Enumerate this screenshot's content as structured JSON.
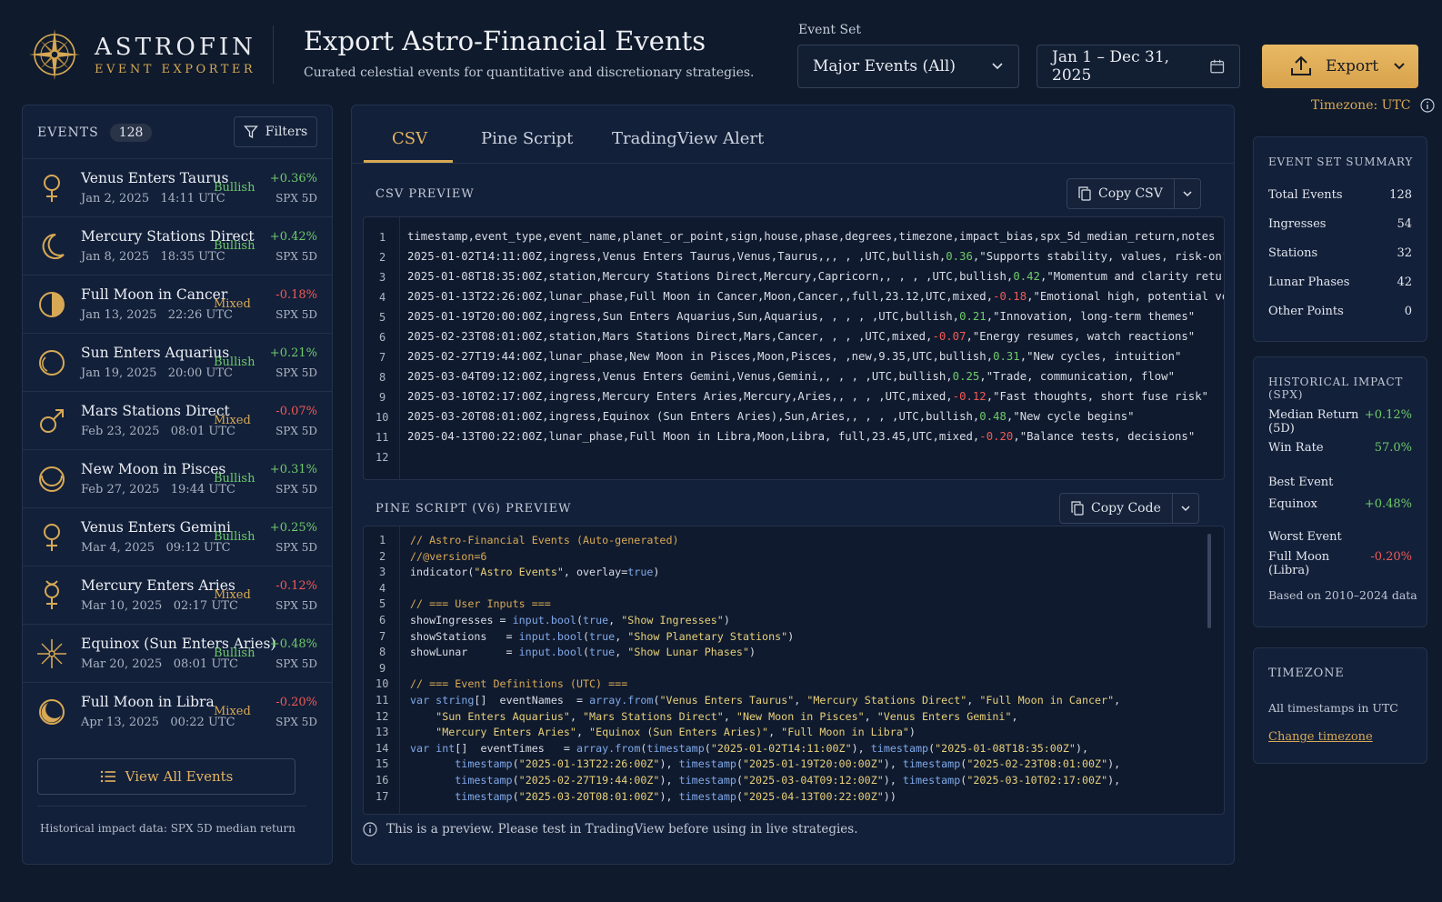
{
  "brand": {
    "title": "ASTROFIN",
    "subtitle": "EVENT EXPORTER"
  },
  "header": {
    "title": "Export Astro-Financial Events",
    "subtitle": "Curated celestial events for quantitative and discretionary strategies.",
    "event_set_label": "Event Set",
    "event_set_value": "Major Events (All)",
    "date_range": "Jan 1 – Dec 31, 2025",
    "export_label": "Export",
    "timezone_note": "Timezone: UTC"
  },
  "events_panel": {
    "title": "EVENTS",
    "count": "128",
    "filters_label": "Filters",
    "items": [
      {
        "glyph": "venus",
        "name": "Venus Enters Taurus",
        "date": "Jan 2, 2025",
        "time": "14:11 UTC",
        "bias": "Bullish",
        "bias_color": "#6ecb6a",
        "return": "+0.36%",
        "return_color": "#6ecb6a",
        "return_label": "SPX 5D"
      },
      {
        "glyph": "crescent",
        "name": "Mercury Stations Direct",
        "date": "Jan 8, 2025",
        "time": "18:35 UTC",
        "bias": "Bullish",
        "bias_color": "#6ecb6a",
        "return": "+0.42%",
        "return_color": "#6ecb6a",
        "return_label": "SPX 5D"
      },
      {
        "glyph": "fullmoon",
        "name": "Full Moon in Cancer",
        "date": "Jan 13, 2025",
        "time": "22:26 UTC",
        "bias": "Mixed",
        "bias_color": "#d7a955",
        "return": "-0.18%",
        "return_color": "#f05a55",
        "return_label": "SPX 5D"
      },
      {
        "glyph": "sun",
        "name": "Sun Enters Aquarius",
        "date": "Jan 19, 2025",
        "time": "20:00 UTC",
        "bias": "Bullish",
        "bias_color": "#6ecb6a",
        "return": "+0.21%",
        "return_color": "#6ecb6a",
        "return_label": "SPX 5D"
      },
      {
        "glyph": "mars",
        "name": "Mars Stations Direct",
        "date": "Feb 23, 2025",
        "time": "08:01 UTC",
        "bias": "Mixed",
        "bias_color": "#d7a955",
        "return": "-0.07%",
        "return_color": "#f05a55",
        "return_label": "SPX 5D"
      },
      {
        "glyph": "newmoon",
        "name": "New Moon in Pisces",
        "date": "Feb 27, 2025",
        "time": "19:44 UTC",
        "bias": "Bullish",
        "bias_color": "#6ecb6a",
        "return": "+0.31%",
        "return_color": "#6ecb6a",
        "return_label": "SPX 5D"
      },
      {
        "glyph": "venus",
        "name": "Venus Enters Gemini",
        "date": "Mar 4, 2025",
        "time": "09:12 UTC",
        "bias": "Bullish",
        "bias_color": "#6ecb6a",
        "return": "+0.25%",
        "return_color": "#6ecb6a",
        "return_label": "SPX 5D"
      },
      {
        "glyph": "mercury",
        "name": "Mercury Enters Aries",
        "date": "Mar 10, 2025",
        "time": "02:17 UTC",
        "bias": "Mixed",
        "bias_color": "#d7a955",
        "return": "-0.12%",
        "return_color": "#f05a55",
        "return_label": "SPX 5D"
      },
      {
        "glyph": "star",
        "name": "Equinox (Sun Enters Aries)",
        "date": "Mar 20, 2025",
        "time": "08:01 UTC",
        "bias": "Bullish",
        "bias_color": "#6ecb6a",
        "return": "+0.48%",
        "return_color": "#6ecb6a",
        "return_label": "SPX 5D"
      },
      {
        "glyph": "fullmoon2",
        "name": "Full Moon in Libra",
        "date": "Apr 13, 2025",
        "time": "00:22 UTC",
        "bias": "Mixed",
        "bias_color": "#d7a955",
        "return": "-0.20%",
        "return_color": "#f05a55",
        "return_label": "SPX 5D"
      }
    ],
    "view_all_label": "View All Events",
    "footnote": "Historical impact data: SPX 5D median return"
  },
  "tabs": [
    "CSV",
    "Pine Script",
    "TradingView Alert"
  ],
  "csv_preview": {
    "title": "CSV PREVIEW",
    "copy_label": "Copy CSV",
    "lines": [
      "timestamp,event_type,event_name,planet_or_point,sign,house,phase,degrees,timezone,impact_bias,spx_5d_median_return,notes",
      "2025-01-02T14:11:00Z,ingress,Venus Enters Taurus,Venus,Taurus,,, , ,UTC,bullish,0.36,\"Supports stability, values, risk-on\"",
      "2025-01-08T18:35:00Z,station,Mercury Stations Direct,Mercury,Capricorn,, , , ,UTC,bullish,0.42,\"Momentum and clarity return\"",
      "2025-01-13T22:26:00Z,lunar_phase,Full Moon in Cancer,Moon,Cancer,,full,23.12,UTC,mixed,-0.18,\"Emotional high, potential volatil",
      "2025-01-19T20:00:00Z,ingress,Sun Enters Aquarius,Sun,Aquarius, , , , ,UTC,bullish,0.21,\"Innovation, long-term themes\"",
      "2025-02-23T08:01:00Z,station,Mars Stations Direct,Mars,Cancer, , , ,UTC,mixed,-0.07,\"Energy resumes, watch reactions\"",
      "2025-02-27T19:44:00Z,lunar_phase,New Moon in Pisces,Moon,Pisces, ,new,9.35,UTC,bullish,0.31,\"New cycles, intuition\"",
      "2025-03-04T09:12:00Z,ingress,Venus Enters Gemini,Venus,Gemini,, , , ,UTC,bullish,0.25,\"Trade, communication, flow\"",
      "2025-03-10T02:17:00Z,ingress,Mercury Enters Aries,Mercury,Aries,, , , ,UTC,mixed,-0.12,\"Fast thoughts, short fuse risk\"",
      "2025-03-20T08:01:00Z,ingress,Equinox (Sun Enters Aries),Sun,Aries,, , , ,UTC,bullish,0.48,\"New cycle begins\"",
      "2025-04-13T00:22:00Z,lunar_phase,Full Moon in Libra,Moon,Libra, full,23.45,UTC,mixed,-0.20,\"Balance tests, decisions\"",
      ""
    ]
  },
  "pine_preview": {
    "title": "PINE SCRIPT (V6) PREVIEW",
    "copy_label": "Copy Code",
    "lines": [
      "// Astro-Financial Events (Auto-generated)",
      "//@version=6",
      "indicator(\"Astro Events\", overlay=true)",
      "",
      "// === User Inputs ===",
      "showIngresses = input.bool(true, \"Show Ingresses\")",
      "showStations   = input.bool(true, \"Show Planetary Stations\")",
      "showLunar      = input.bool(true, \"Show Lunar Phases\")",
      "",
      "// === Event Definitions (UTC) ===",
      "var string[]  eventNames  = array.from(\"Venus Enters Taurus\", \"Mercury Stations Direct\", \"Full Moon in Cancer\",",
      "    \"Sun Enters Aquarius\", \"Mars Stations Direct\", \"New Moon in Pisces\", \"Venus Enters Gemini\",",
      "    \"Mercury Enters Aries\", \"Equinox (Sun Enters Aries)\", \"Full Moon in Libra\")",
      "var int[]  eventTimes   = array.from(timestamp(\"2025-01-02T14:11:00Z\"), timestamp(\"2025-01-08T18:35:00Z\"),",
      "       timestamp(\"2025-01-13T22:26:00Z\"), timestamp(\"2025-01-19T20:00:00Z\"), timestamp(\"2025-02-23T08:01:00Z\"),",
      "       timestamp(\"2025-02-27T19:44:00Z\"), timestamp(\"2025-03-04T09:12:00Z\"), timestamp(\"2025-03-10T02:17:00Z\"),",
      "       timestamp(\"2025-03-20T08:01:00Z\"), timestamp(\"2025-04-13T00:22:00Z\"))"
    ],
    "note": "This is a preview. Please test in TradingView before using in live strategies."
  },
  "summary": {
    "title": "EVENT SET SUMMARY",
    "rows": [
      {
        "label": "Total Events",
        "value": "128"
      },
      {
        "label": "Ingresses",
        "value": "54"
      },
      {
        "label": "Stations",
        "value": "32"
      },
      {
        "label": "Lunar Phases",
        "value": "42"
      },
      {
        "label": "Other Points",
        "value": "0"
      }
    ]
  },
  "impact": {
    "title": "HISTORICAL IMPACT (SPX)",
    "median_label": "Median Return (5D)",
    "median_value": "+0.12%",
    "winrate_label": "Win Rate",
    "winrate_value": "57.0%",
    "best_label": "Best Event",
    "best_name": "Equinox",
    "best_value": "+0.48%",
    "worst_label": "Worst Event",
    "worst_name": "Full Moon (Libra)",
    "worst_value": "-0.20%",
    "basis": "Based on 2010–2024 data"
  },
  "timezone_panel": {
    "title": "TIMEZONE",
    "text": "All timestamps in UTC",
    "link": "Change timezone"
  },
  "colors": {
    "accent": "#d7a955",
    "positive": "#6ecb6a",
    "negative": "#f05a55",
    "background": "#0f1a2c"
  }
}
